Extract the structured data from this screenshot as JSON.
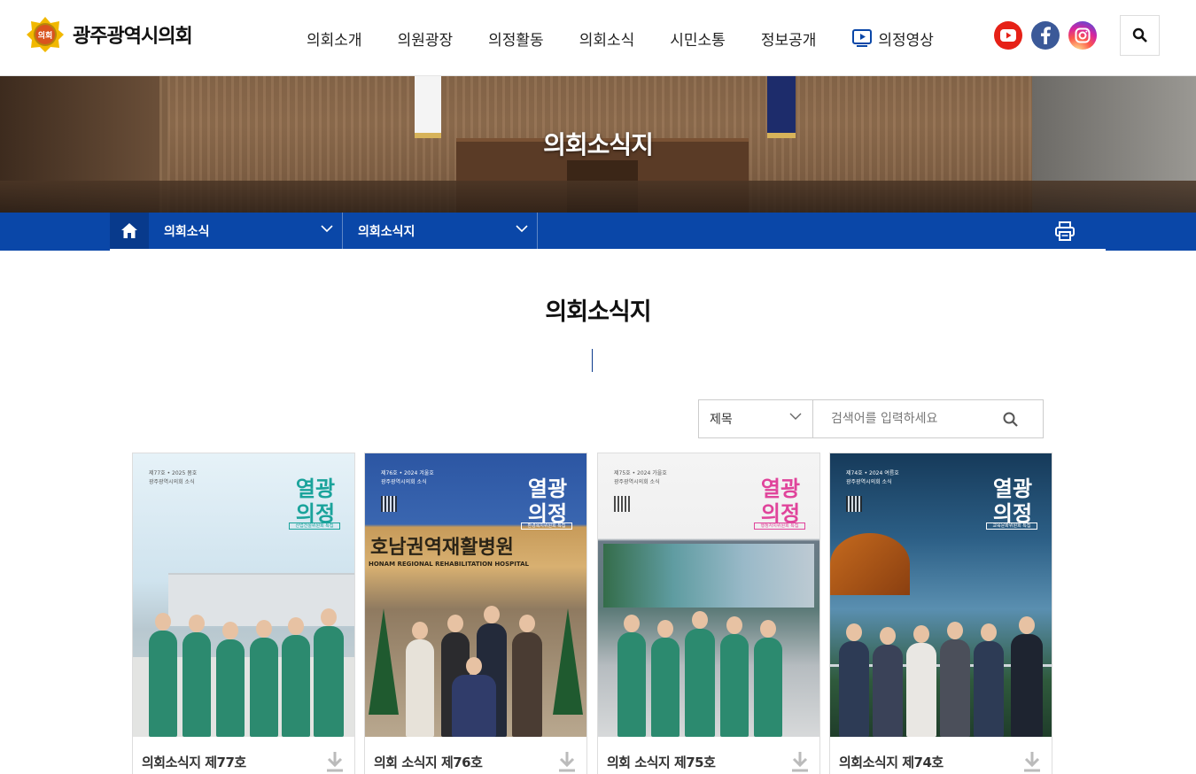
{
  "header": {
    "logo_text": "광주광역시의회",
    "logo_badge": "의회",
    "nav": [
      "의회소개",
      "의원광장",
      "의정활동",
      "의회소식",
      "시민소통",
      "정보공개",
      "의정영상"
    ],
    "sns": [
      "youtube-icon",
      "facebook-icon",
      "instagram-icon"
    ]
  },
  "banner": {
    "title": "의회소식지"
  },
  "location": {
    "home_icon": "home-icon",
    "depth1": "의회소식",
    "depth2": "의회소식지",
    "print_icon": "printer-icon"
  },
  "main": {
    "title": "의회소식지",
    "search": {
      "select_value": "제목",
      "placeholder": "검색어를 입력하세요"
    },
    "cards": [
      {
        "title": "의회소식지 제77호",
        "cover_meta": "제77호 • 2025 봄호",
        "cover_sub": "광주광역시의회 소식",
        "tag": "산업건설위원회 특집"
      },
      {
        "title": "의회 소식지 제76호",
        "cover_meta": "제76호 • 2024 겨울호",
        "cover_sub": "광주광역시의회 소식",
        "tag": "환경복지위원회 특집",
        "sign": "호남권역재활병원",
        "sign_en": "HONAM REGIONAL REHABILITATION HOSPITAL"
      },
      {
        "title": "의회 소식지 제75호",
        "cover_meta": "제75호 • 2024 가을호",
        "cover_sub": "광주광역시의회 소식",
        "tag": "행정자치위원회 특집"
      },
      {
        "title": "의회소식지 제74호",
        "cover_meta": "제74호 • 2024 여름호",
        "cover_sub": "광주광역시의회 소식",
        "tag": "교육문화위원회 특집"
      }
    ]
  },
  "colors": {
    "brand_blue": "#0a47a8",
    "youtube": "#e62117",
    "facebook": "#3b5998",
    "instagram": "#c13584",
    "cover_teal": "#1aa39b",
    "cover_pink": "#e0449b"
  }
}
